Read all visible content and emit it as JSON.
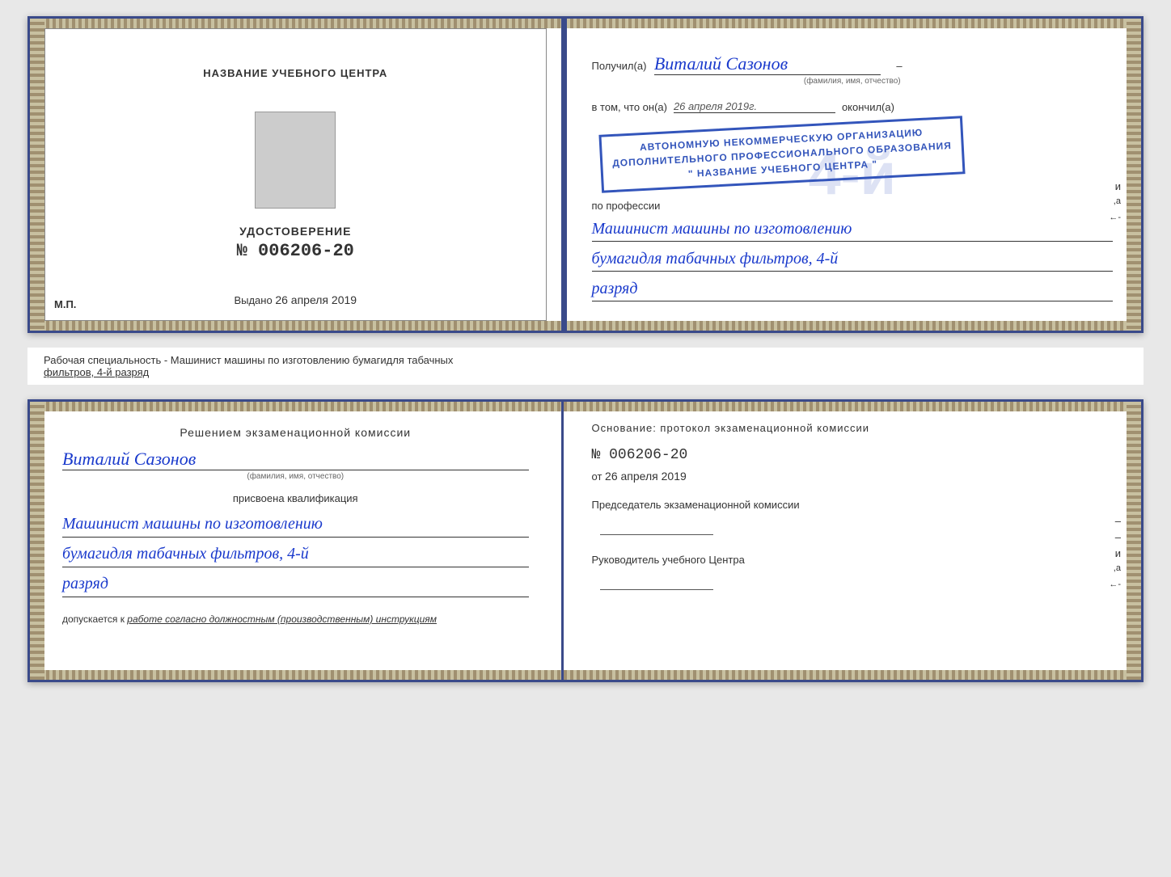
{
  "page": {
    "background_color": "#e8e8e8"
  },
  "top_cert": {
    "left_page": {
      "title": "НАЗВАНИЕ УЧЕБНОГО ЦЕНТРА",
      "cert_type": "УДОСТОВЕРЕНИЕ",
      "cert_number": "№ 006206-20",
      "issued_label": "Выдано",
      "issued_date": "26 апреля 2019",
      "mp_label": "М.П."
    },
    "right_page": {
      "recipient_prefix": "Получил(а)",
      "recipient_name": "Виталий Сазонов",
      "fio_label": "(фамилия, имя, отчество)",
      "vtom_prefix": "в том, что он(а)",
      "vtom_date": "26 апреля 2019г.",
      "okoncil": "окончил(а)",
      "stamp_line1": "АВТОНОМНУЮ НЕКОММЕРЧЕСКУЮ ОРГАНИЗАЦИЮ",
      "stamp_line2": "ДОПОЛНИТЕЛЬНОГО ПРОФЕССИОНАЛЬНОГО ОБРАЗОВАНИЯ",
      "stamp_line3": "\" НАЗВАНИЕ УЧЕБНОГО ЦЕНТРА \"",
      "po_professii": "по профессии",
      "profession_line1": "Машинист машины по изготовлению",
      "profession_line2": "бумагидля табачных фильтров, 4-й",
      "profession_line3": "разряд"
    }
  },
  "info_bar": {
    "text_start": "Рабочая специальность - Машинист машины по изготовлению бумагидля табачных",
    "text_underlined": "фильтров, 4-й разряд"
  },
  "bottom_cert": {
    "left_page": {
      "title": "Решением экзаменационной комиссии",
      "name": "Виталий Сазонов",
      "fio_label": "(фамилия, имя, отчество)",
      "prisvoena_label": "присвоена квалификация",
      "qual_line1": "Машинист машины по изготовлению",
      "qual_line2": "бумагидля табачных фильтров, 4-й",
      "qual_line3": "разряд",
      "dopusk_prefix": "допускается к",
      "dopusk_text": "работе согласно должностным (производственным) инструкциям"
    },
    "right_page": {
      "osnov_label": "Основание: протокол экзаменационной комиссии",
      "number": "№ 006206-20",
      "ot_label": "от",
      "ot_date": "26 апреля 2019",
      "chairman_label": "Председатель экзаменационной комиссии",
      "rukov_label": "Руководитель учебного Центра"
    }
  }
}
